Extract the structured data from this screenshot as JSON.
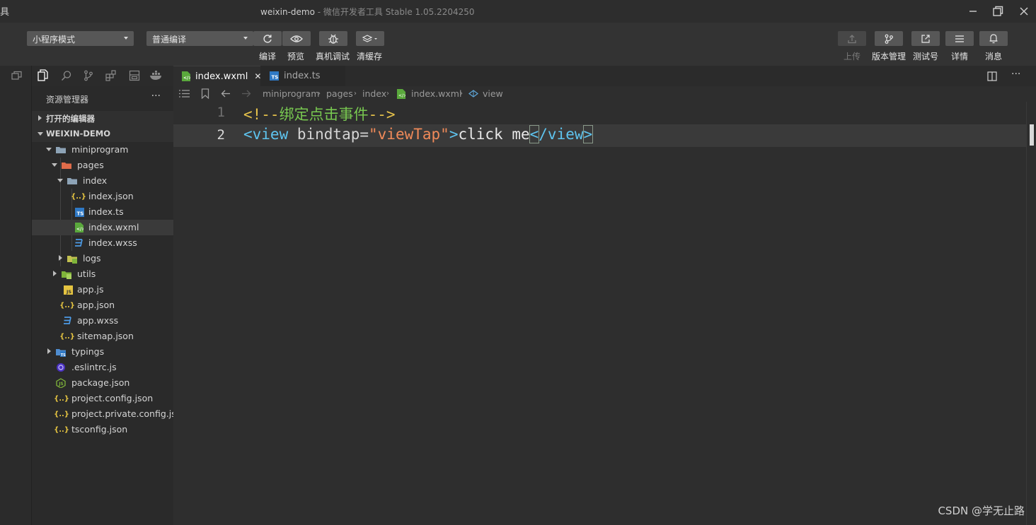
{
  "titlebar": {
    "app_glyph": "具",
    "project": "weixin-demo",
    "separator": " - ",
    "subtitle": "微信开发者工具 Stable 1.05.2204250"
  },
  "toolbar": {
    "mode_select": "小程序模式",
    "compile_select": "普通编译",
    "left_actions": [
      {
        "label": "编译",
        "icon": "refresh-icon"
      },
      {
        "label": "预览",
        "icon": "eye-icon"
      },
      {
        "label": "真机调试",
        "icon": "bug-icon"
      },
      {
        "label": "清缓存",
        "icon": "layers-icon"
      }
    ],
    "right_actions": [
      {
        "label": "上传",
        "icon": "upload-icon",
        "disabled": true
      },
      {
        "label": "版本管理",
        "icon": "branch-icon"
      },
      {
        "label": "测试号",
        "icon": "external-link-icon"
      },
      {
        "label": "详情",
        "icon": "menu-icon"
      },
      {
        "label": "消息",
        "icon": "bell-icon"
      }
    ]
  },
  "sidebar": {
    "header": "资源管理器",
    "more": "···",
    "open_editors": "打开的编辑器",
    "project_root": "WEIXIN-DEMO",
    "tree": [
      {
        "label": "miniprogram",
        "type": "folder"
      },
      {
        "label": "pages",
        "type": "folder"
      },
      {
        "label": "index",
        "type": "folder"
      },
      {
        "label": "index.json",
        "type": "json"
      },
      {
        "label": "index.ts",
        "type": "ts"
      },
      {
        "label": "index.wxml",
        "type": "wxml"
      },
      {
        "label": "index.wxss",
        "type": "wxss"
      },
      {
        "label": "logs",
        "type": "folder"
      },
      {
        "label": "utils",
        "type": "folder"
      },
      {
        "label": "app.js",
        "type": "js"
      },
      {
        "label": "app.json",
        "type": "json"
      },
      {
        "label": "app.wxss",
        "type": "wxss"
      },
      {
        "label": "sitemap.json",
        "type": "json"
      },
      {
        "label": "typings",
        "type": "folder"
      },
      {
        "label": ".eslintrc.js",
        "type": "eslint"
      },
      {
        "label": "package.json",
        "type": "node"
      },
      {
        "label": "project.config.json",
        "type": "json"
      },
      {
        "label": "project.private.config.js...",
        "type": "json"
      },
      {
        "label": "tsconfig.json",
        "type": "json"
      }
    ]
  },
  "tabs": [
    {
      "label": "index.wxml",
      "active": true,
      "close": "✕"
    },
    {
      "label": "index.ts",
      "active": false
    }
  ],
  "breadcrumb": [
    "miniprogram",
    "pages",
    "index",
    "index.wxml",
    "view"
  ],
  "editor": {
    "lines": [
      {
        "number": "1",
        "comment_open": "<!--",
        "comment_text": "绑定点击事件",
        "comment_close": "-->"
      },
      {
        "number": "2",
        "tag_open": "<view",
        "attr": " bindtap=",
        "value": "\"viewTap\"",
        "tag_gt": ">",
        "text": "click me",
        "close_lt": "<",
        "close_tag": "/view",
        "close_gt": ">"
      }
    ]
  },
  "watermark": "CSDN @学无止路",
  "colors": {
    "background": "#2e2e2e",
    "tag": "#5ec4ef",
    "string": "#f08a59",
    "comment": "#e6c24b",
    "comment_text": "#78c850"
  }
}
